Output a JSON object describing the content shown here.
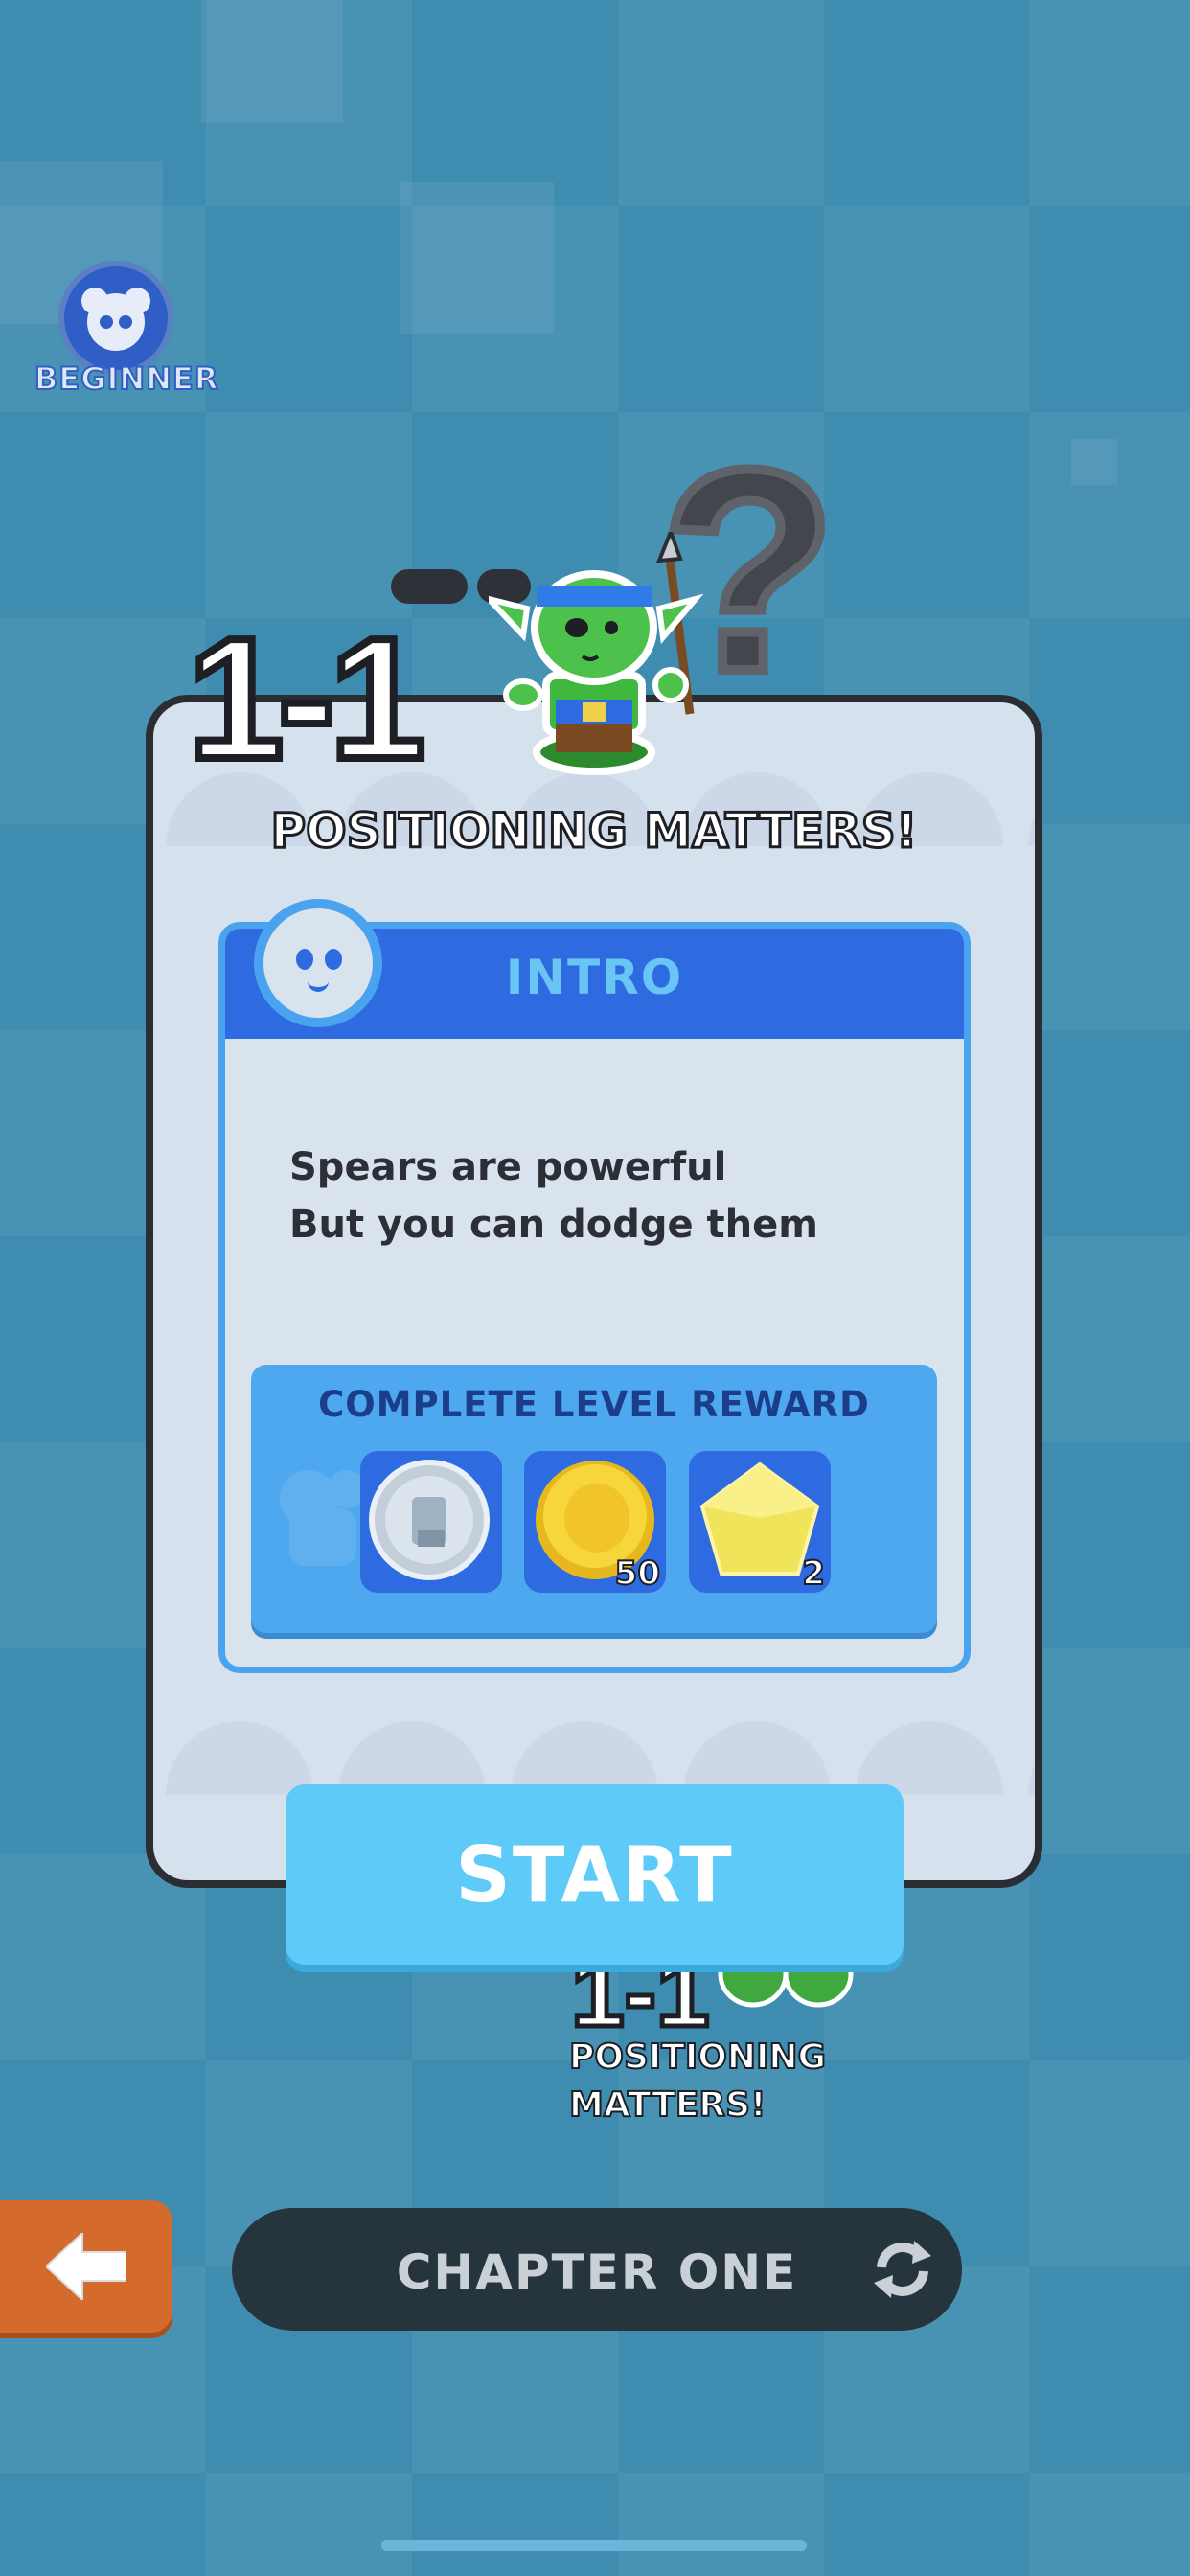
{
  "badge": {
    "label": "BEGINNER"
  },
  "level": {
    "number": "1-1",
    "title": "POSITIONING MATTERS!"
  },
  "intro": {
    "header": "INTRO",
    "lines": [
      "Spears are powerful",
      "But you can dodge them"
    ]
  },
  "reward": {
    "title": "COMPLETE LEVEL REWARD",
    "items": [
      {
        "icon": "silver-token-icon",
        "qty": ""
      },
      {
        "icon": "gold-coin-icon",
        "qty": "50"
      },
      {
        "icon": "yellow-gem-icon",
        "qty": "2"
      }
    ]
  },
  "buttons": {
    "start_label": "START"
  },
  "next_level": {
    "number": "1-1",
    "title_line1": "POSITIONING",
    "title_line2": "MATTERS!"
  },
  "chapter": {
    "label": "CHAPTER ONE"
  },
  "colors": {
    "accent_blue": "#2f6be0",
    "start_button": "#5ecaf7",
    "back_button": "#d46a2c"
  }
}
